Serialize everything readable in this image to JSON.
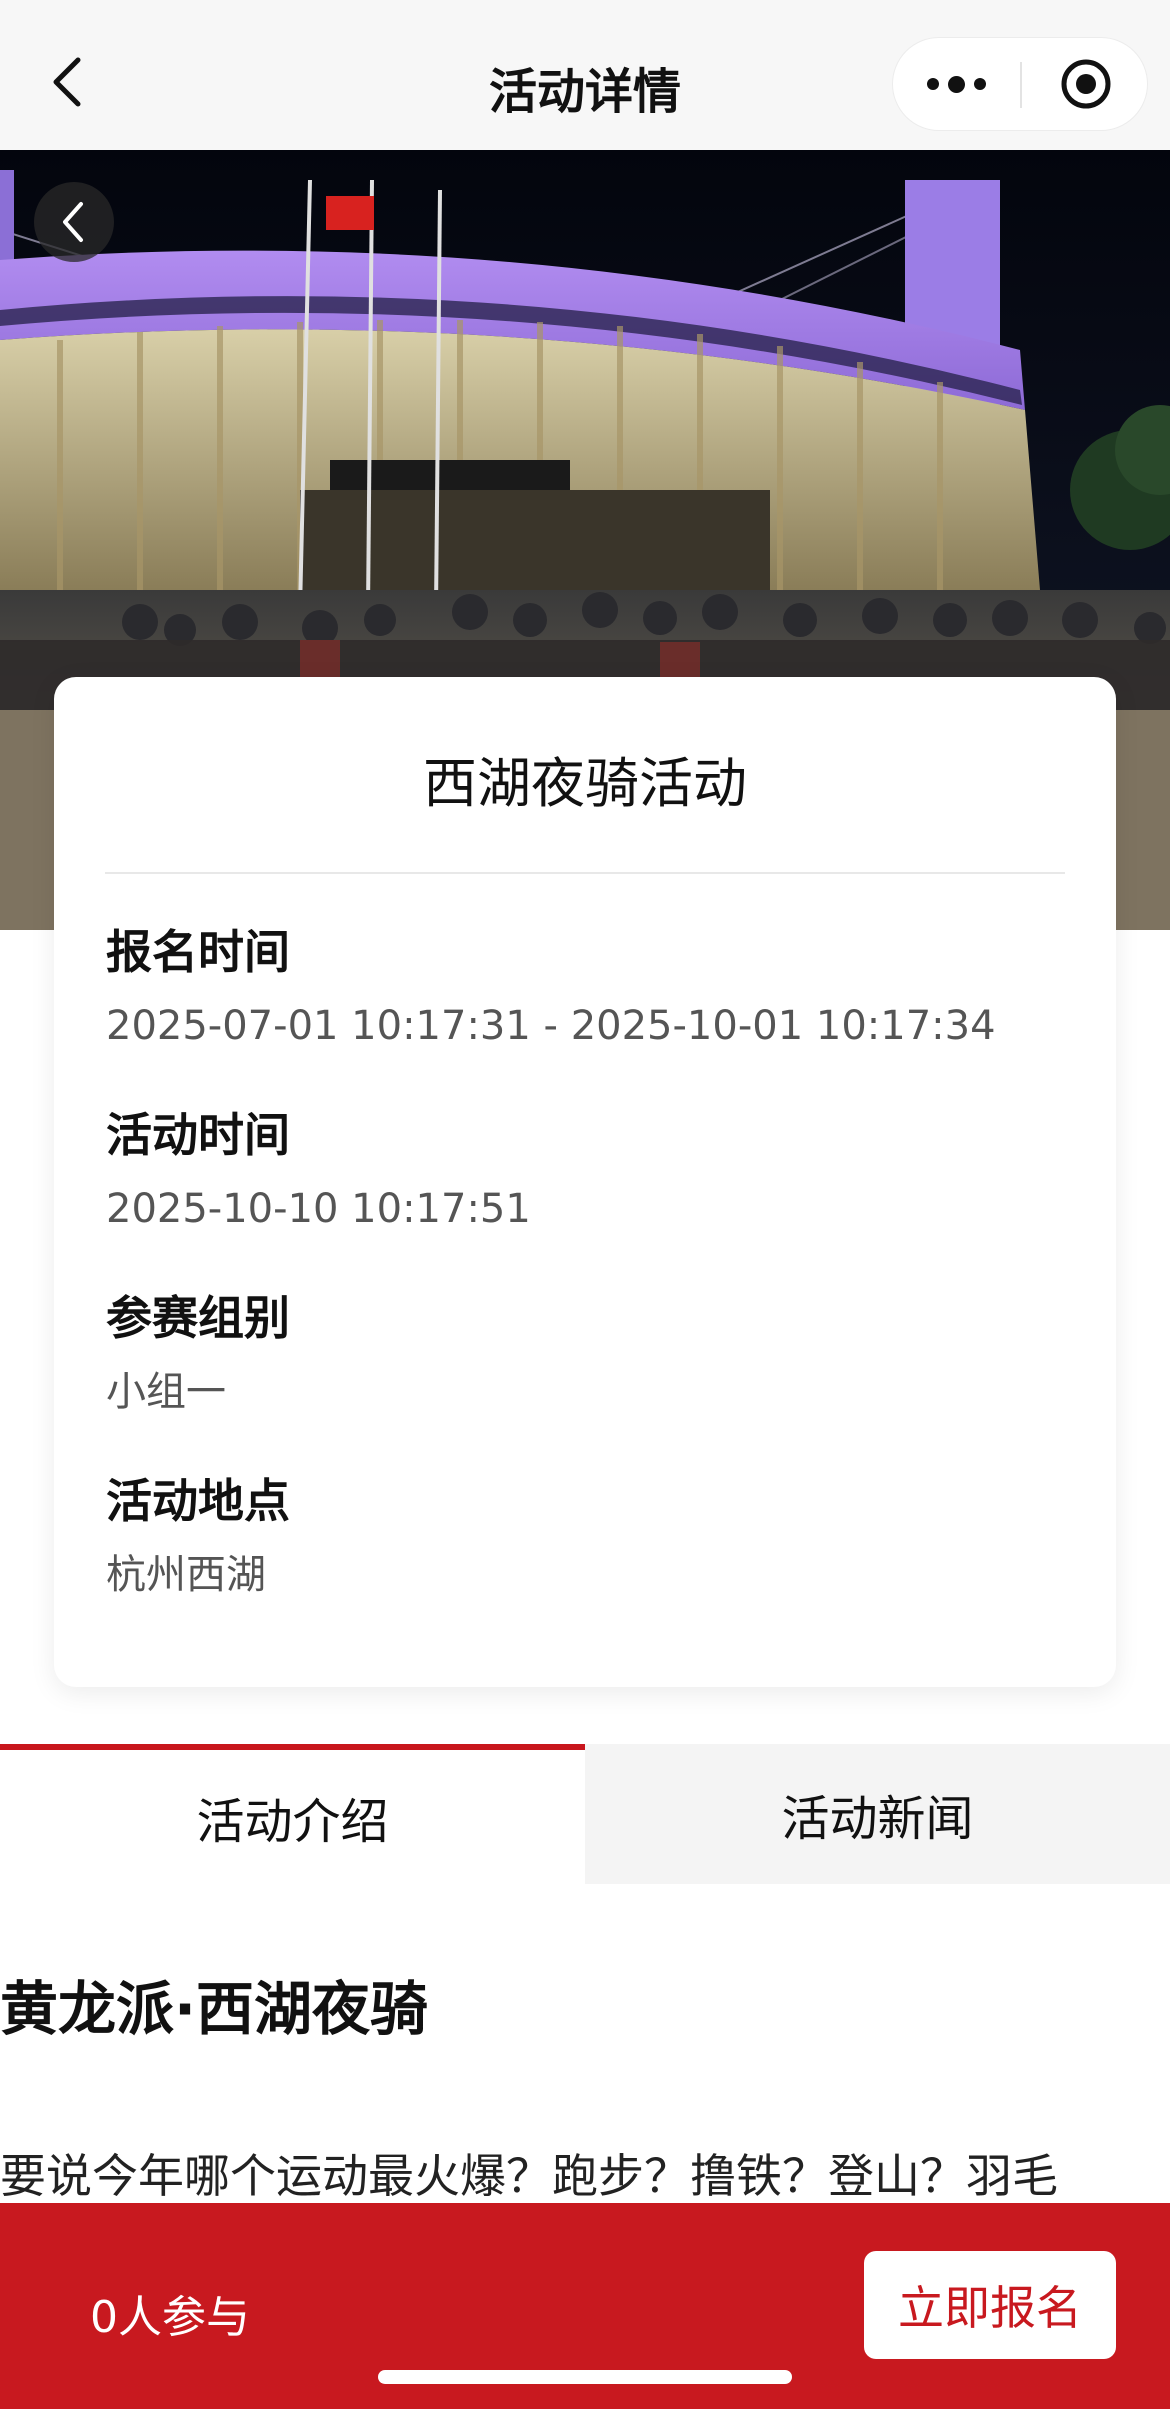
{
  "navbar": {
    "title": "活动详情"
  },
  "event": {
    "title": "西湖夜骑活动",
    "fields": [
      {
        "label": "报名时间",
        "value": "2025-07-01 10:17:31 - 2025-10-01 10:17:34"
      },
      {
        "label": "活动时间",
        "value": "2025-10-10 10:17:51"
      },
      {
        "label": "参赛组别",
        "value": "小组一"
      },
      {
        "label": "活动地点",
        "value": "杭州西湖"
      }
    ]
  },
  "tabs": [
    {
      "label": "活动介绍",
      "active": true
    },
    {
      "label": "活动新闻",
      "active": false
    }
  ],
  "article": {
    "title": "黄龙派·西湖夜骑",
    "first_line": "要说今年哪个运动最火爆？跑步？撸铁？登山？羽毛"
  },
  "bottom_bar": {
    "participants": "0人参与",
    "signup_label": "立即报名"
  },
  "colors": {
    "accent": "#c8191f",
    "tab_indicator": "#c8161d"
  }
}
